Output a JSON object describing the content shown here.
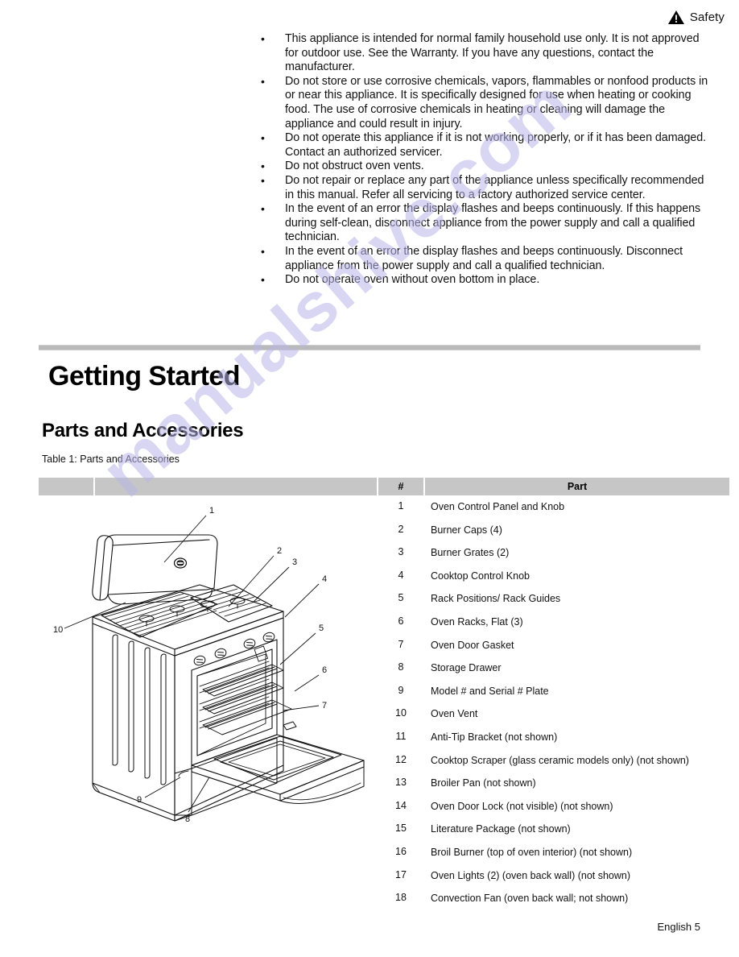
{
  "header": {
    "icon": "warning-triangle-icon",
    "label": "Safety"
  },
  "safety": {
    "bullet_char": "•",
    "items": [
      "This appliance is intended for normal family household use only. It is not approved for outdoor use. See the Warranty. If you have any questions, contact the manufacturer.",
      "Do not store or use corrosive chemicals, vapors, flammables or nonfood products in or near this appliance. It is specifically designed for use when heating or cooking food. The use of corrosive chemicals in heating or cleaning will damage the appliance and could result in injury.",
      "Do not operate this appliance if it is not working properly, or if it has been damaged. Contact an authorized servicer.",
      "Do not obstruct oven vents.",
      "Do not repair or replace any part of the appliance unless specifically recommended in this manual. Refer all servicing to a factory authorized service center.",
      " In the event of an error the display flashes and beeps continuously. If this happens during self-clean, disconnect appliance from the power supply and call a qualified technician.",
      "In the event of an error the display flashes and beeps continuously. Disconnect appliance from the power supply and call a qualified technician.",
      "Do not operate oven without oven bottom in place."
    ]
  },
  "headings": {
    "chapter_title": "Getting Started",
    "section_title": "Parts and Accessories",
    "table_caption": "Table 1: Parts and Accessories"
  },
  "table": {
    "columns": {
      "figure_left": "",
      "figure_main": "",
      "number": "#",
      "part": "Part"
    },
    "rows": [
      {
        "num": "1",
        "part": "Oven Control Panel and Knob"
      },
      {
        "num": "2",
        "part": "Burner Caps (4)"
      },
      {
        "num": "3",
        "part": "Burner Grates (2)"
      },
      {
        "num": "4",
        "part": "Cooktop Control Knob"
      },
      {
        "num": "5",
        "part": "Rack Positions/ Rack Guides"
      },
      {
        "num": "6",
        "part": "Oven Racks, Flat (3)"
      },
      {
        "num": "7",
        "part": "Oven Door Gasket"
      },
      {
        "num": "8",
        "part": "Storage Drawer"
      },
      {
        "num": "9",
        "part": "Model # and Serial # Plate"
      },
      {
        "num": "10",
        "part": "Oven Vent"
      },
      {
        "num": "11",
        "part": "Anti-Tip Bracket (not shown)"
      },
      {
        "num": "12",
        "part": "Cooktop Scraper (glass ceramic models only) (not shown)"
      },
      {
        "num": "13",
        "part": "Broiler Pan (not shown)"
      },
      {
        "num": "14",
        "part": "Oven Door Lock (not visible) (not shown)"
      },
      {
        "num": "15",
        "part": "Literature Package (not shown)"
      },
      {
        "num": "16",
        "part": "Broil Burner (top of oven interior) (not shown)"
      },
      {
        "num": "17",
        "part": "Oven Lights (2) (oven back wall) (not shown)"
      },
      {
        "num": "18",
        "part": "Convection Fan (oven back wall; not shown)"
      }
    ]
  },
  "figure": {
    "name": "gas-range-parts-illustration",
    "callouts": [
      "1",
      "2",
      "3",
      "4",
      "5",
      "6",
      "7",
      "8",
      "9",
      "10"
    ]
  },
  "watermark": {
    "text": "manualshive.com",
    "color": "#b9b6e8"
  },
  "footer": {
    "text": "English 5"
  },
  "colors": {
    "table_header_bg": "#c6c6c6",
    "rule": "#b9b9b9",
    "text": "#111111"
  }
}
